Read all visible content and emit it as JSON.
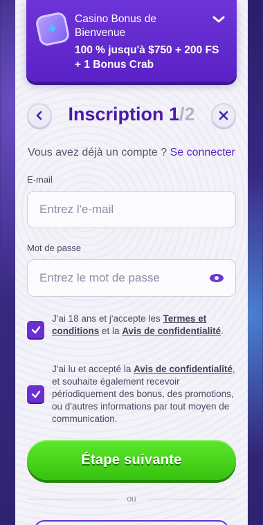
{
  "banner": {
    "title": "Casino Bonus de Bienvenue",
    "offer": "100 % jusqu'à $750 + 200 FS + 1 Bonus Crab"
  },
  "header": {
    "title": "Inscription 1",
    "total": "/2"
  },
  "login": {
    "question": "Vous avez déjà un compte ?",
    "link": "Se connecter"
  },
  "email": {
    "label": "E-mail",
    "placeholder": "Entrez l'e-mail"
  },
  "password": {
    "label": "Mot de passe",
    "placeholder": "Entrez le mot de passe"
  },
  "consents": {
    "age": {
      "prefix": "J'ai 18 ans et j'accepte les",
      "terms": "Termes et conditions",
      "middle": "et la",
      "privacy": "Avis de confidentialité",
      "suffix": "."
    },
    "marketing": {
      "prefix": "J'ai lu et accepté la",
      "privacy": "Avis de confidentialité",
      "suffix": ", et souhaite également recevoir périodiquement des bonus, des promotions, ou d'autres informations par tout moyen de communication."
    }
  },
  "next_button": "Étape suivante",
  "or_text": "ou",
  "colors": {
    "accent": "#5a22c6",
    "primary_text": "#4b1aa8",
    "cta": "#3fd114"
  }
}
